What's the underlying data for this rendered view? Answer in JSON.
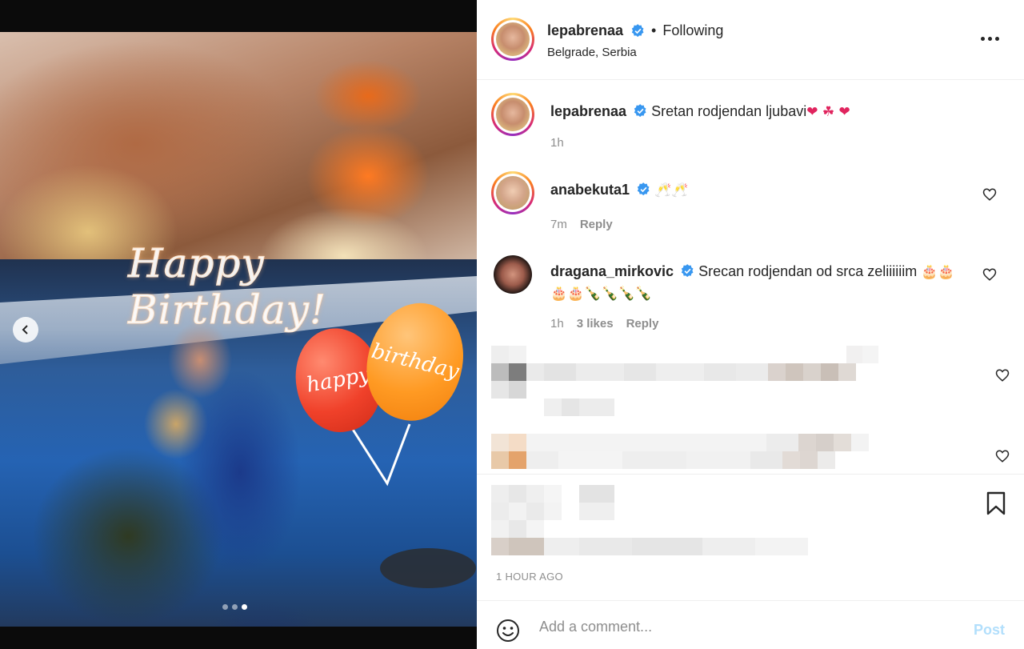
{
  "post": {
    "author": "lepabrenaa",
    "follow_status": "Following",
    "separator": "•",
    "location": "Belgrade, Serbia",
    "more_icon": "more-horizontal-icon"
  },
  "media": {
    "overlay_text": "Happy Birthday!",
    "balloon_left_text": "happy",
    "balloon_right_text": "birthday",
    "carousel_current": 3,
    "carousel_total": 3
  },
  "comments": [
    {
      "username": "lepabrenaa",
      "text": "Sretan rodjendan ljubavi",
      "emojis": "❤ ☘ ❤",
      "time": "1h"
    },
    {
      "username": "anabekuta1",
      "text": "",
      "emojis": "🥂🥂",
      "time": "7m",
      "reply": "Reply"
    },
    {
      "username": "dragana_mirkovic",
      "text": "Srecan rodjendan od srca zeliiiiiim",
      "emojis_line1": "🎂🎂",
      "emojis_line2": "🎂🎂🍾🍾🍾🍾",
      "time": "1h",
      "likes": "3 likes",
      "reply": "Reply"
    }
  ],
  "footer": {
    "timestamp": "1 HOUR AGO",
    "comment_placeholder": "Add a comment...",
    "post_label": "Post"
  },
  "colors": {
    "verified_blue": "#3897f0",
    "post_button_disabled": "#b2dffc",
    "secondary_text": "#8e8e8e"
  }
}
